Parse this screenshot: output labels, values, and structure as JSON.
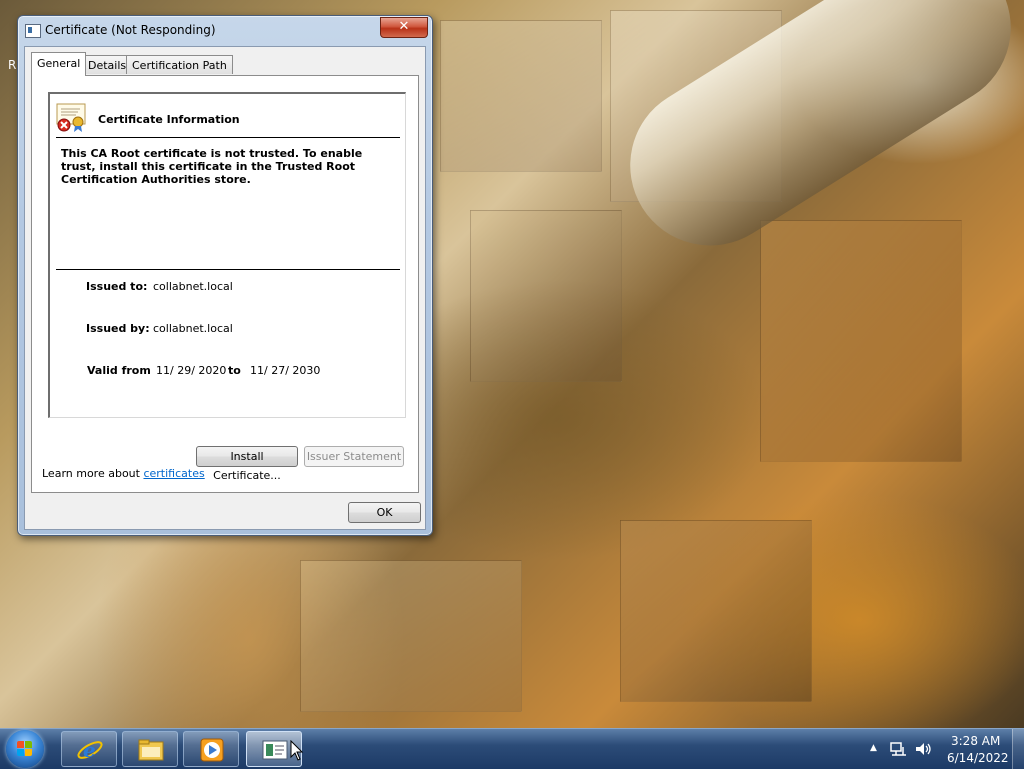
{
  "desktop": {
    "stray_letter": "R"
  },
  "window": {
    "title": "Certificate (Not Responding)",
    "close_glyph": "✕",
    "tabs": [
      {
        "label": "General",
        "active": true
      },
      {
        "label": "Details",
        "active": false
      },
      {
        "label": "Certification Path",
        "active": false
      }
    ],
    "info": {
      "heading": "Certificate Information",
      "warning": "This CA Root certificate is not trusted. To enable trust, install this certificate in the Trusted Root Certification Authorities store.",
      "issued_to_label": "Issued to:",
      "issued_to_value": "collabnet.local",
      "issued_by_label": "Issued by:",
      "issued_by_value": "collabnet.local",
      "valid_from_label": "Valid from",
      "valid_from_value": "11/ 29/ 2020",
      "to_label": "to",
      "valid_to_value": "11/ 27/ 2030"
    },
    "buttons": {
      "install": "Install Certificate...",
      "issuer_statement": "Issuer Statement",
      "issuer_statement_enabled": false,
      "ok": "OK"
    },
    "learn_more_prefix": "Learn more about",
    "learn_more_link": "certificates"
  },
  "taskbar": {
    "start": "start-orb",
    "pinned": [
      {
        "name": "internet-explorer-icon",
        "active": false
      },
      {
        "name": "file-explorer-icon",
        "active": false
      },
      {
        "name": "media-player-icon",
        "active": false
      },
      {
        "name": "certificate-window-icon",
        "active": true
      }
    ],
    "tray": [
      "show-hidden-icons-arrow",
      "network-icon",
      "volume-icon"
    ],
    "clock": {
      "time": "3:28 AM",
      "date": "6/14/2022"
    }
  },
  "colors": {
    "taskbar": "#1c3a66",
    "close_button": "#c8452a",
    "link": "#0066cc",
    "dialog_frame": "#b3c8e2"
  }
}
